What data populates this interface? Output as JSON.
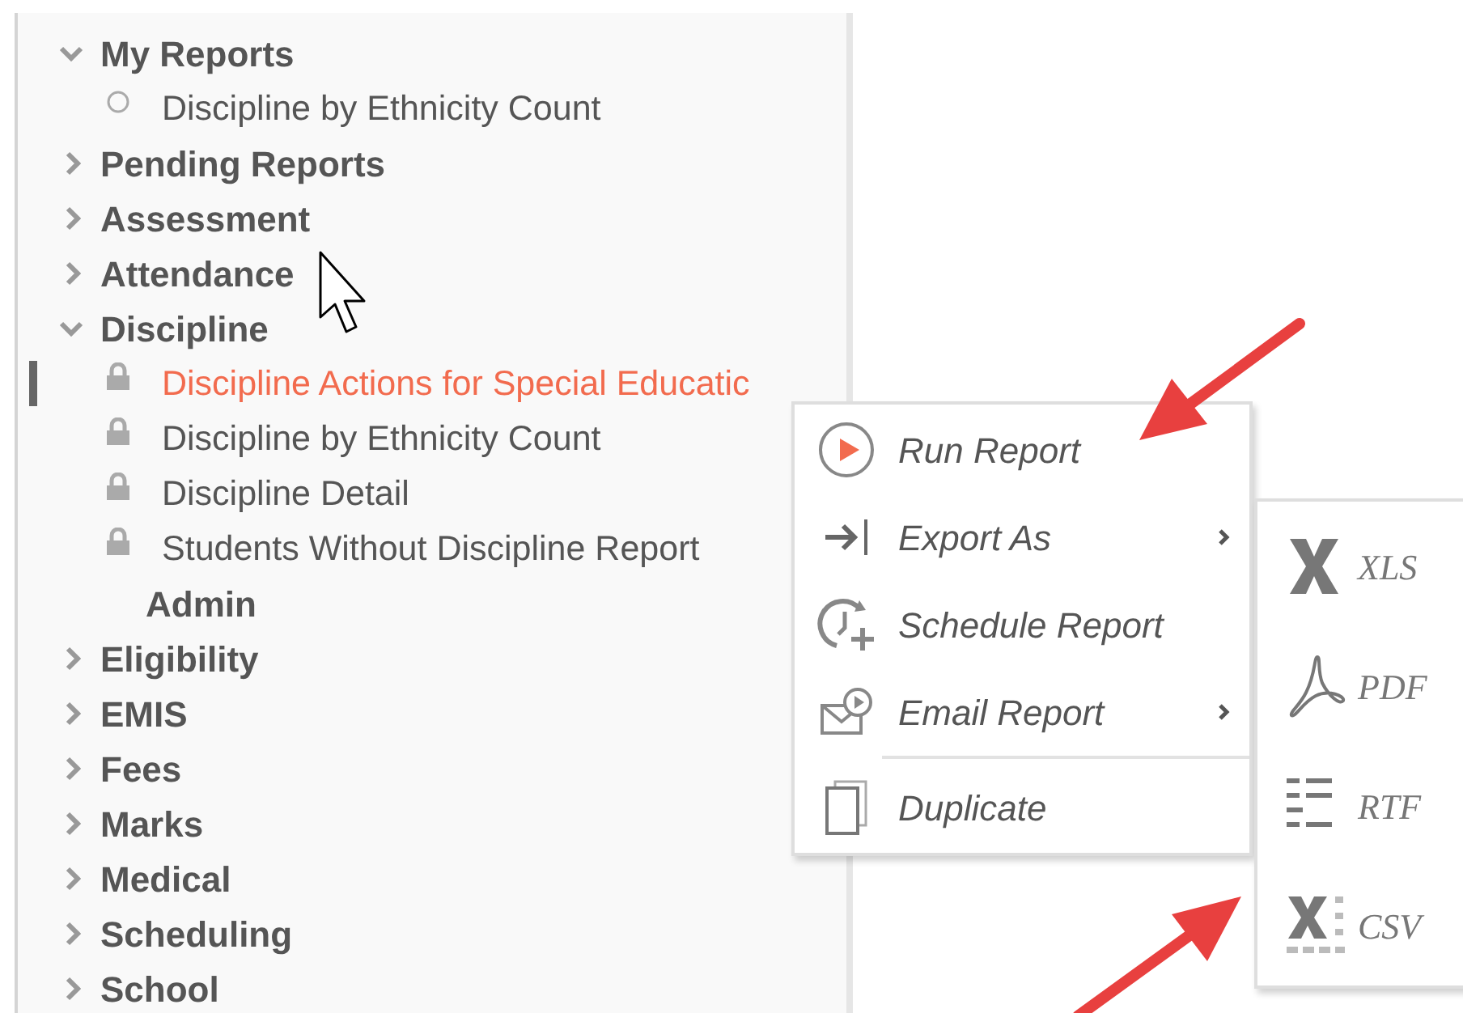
{
  "tree": [
    {
      "kind": "group",
      "label": "My Reports",
      "expanded": true,
      "children": [
        {
          "kind": "report",
          "label": "Discipline by Ethnicity Count",
          "locked": false,
          "selected": false
        }
      ]
    },
    {
      "kind": "group",
      "label": "Pending Reports",
      "expanded": false
    },
    {
      "kind": "group",
      "label": "Assessment",
      "expanded": false
    },
    {
      "kind": "group",
      "label": "Attendance",
      "expanded": false
    },
    {
      "kind": "group",
      "label": "Discipline",
      "expanded": true,
      "children": [
        {
          "kind": "report",
          "label": "Discipline Actions for Special Educatic",
          "locked": true,
          "selected": true
        },
        {
          "kind": "report",
          "label": "Discipline by Ethnicity Count",
          "locked": true,
          "selected": false
        },
        {
          "kind": "report",
          "label": "Discipline Detail",
          "locked": true,
          "selected": false
        },
        {
          "kind": "report",
          "label": "Students Without Discipline Report",
          "locked": true,
          "selected": false
        },
        {
          "kind": "subheading",
          "label": "Admin"
        }
      ]
    },
    {
      "kind": "group",
      "label": "Eligibility",
      "expanded": false
    },
    {
      "kind": "group",
      "label": "EMIS",
      "expanded": false
    },
    {
      "kind": "group",
      "label": "Fees",
      "expanded": false
    },
    {
      "kind": "group",
      "label": "Marks",
      "expanded": false
    },
    {
      "kind": "group",
      "label": "Medical",
      "expanded": false
    },
    {
      "kind": "group",
      "label": "Scheduling",
      "expanded": false
    },
    {
      "kind": "group",
      "label": "School",
      "expanded": false
    }
  ],
  "context_menu": {
    "items": [
      {
        "label": "Run Report",
        "submenu": false
      },
      {
        "label": "Export As",
        "submenu": true
      },
      {
        "label": "Schedule Report",
        "submenu": false
      },
      {
        "label": "Email Report",
        "submenu": true
      }
    ],
    "extra_items": [
      {
        "label": "Duplicate",
        "submenu": false
      }
    ]
  },
  "export_submenu": {
    "items": [
      {
        "label": "XLS"
      },
      {
        "label": "PDF"
      },
      {
        "label": "RTF"
      },
      {
        "label": "CSV"
      }
    ]
  }
}
